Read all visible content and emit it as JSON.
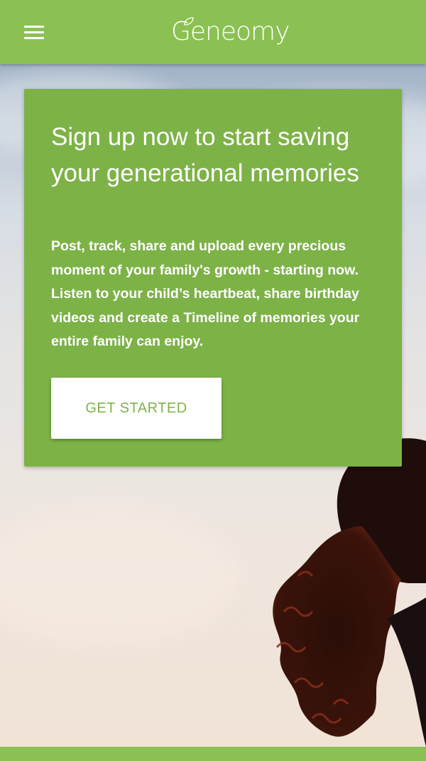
{
  "header": {
    "brand": "Geneomy",
    "menu_icon": "hamburger-menu-icon",
    "background_color": "#8bc152"
  },
  "hero": {
    "image": "silhouette-of-child-with-curly-hair-against-sky"
  },
  "card": {
    "title": "Sign up now to start saving your generational memories",
    "body": "Post, track, share and upload every precious moment of your family's growth - starting now. Listen to your child’s heartbeat, share birthday videos and create a Timeline of memories your entire family can enjoy.",
    "cta_label": "GET STARTED",
    "background_color": "#7db247",
    "cta_text_color": "#7db247"
  }
}
